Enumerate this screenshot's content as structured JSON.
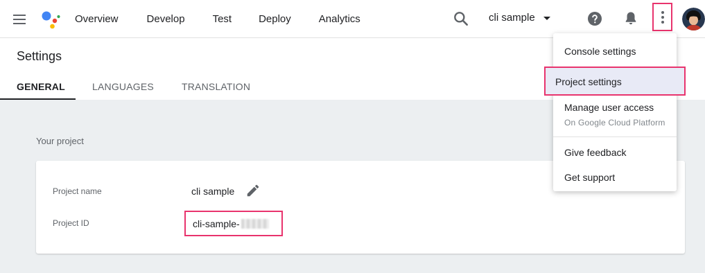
{
  "nav": {
    "items": [
      {
        "label": "Overview"
      },
      {
        "label": "Develop"
      },
      {
        "label": "Test"
      },
      {
        "label": "Deploy"
      },
      {
        "label": "Analytics"
      }
    ]
  },
  "project_selector": {
    "value": "cli sample"
  },
  "settings": {
    "title": "Settings",
    "tabs": [
      {
        "label": "GENERAL",
        "active": true
      },
      {
        "label": "LANGUAGES",
        "active": false
      },
      {
        "label": "TRANSLATION",
        "active": false
      }
    ]
  },
  "your_project": {
    "section_label": "Your project",
    "fields": [
      {
        "label": "Project name",
        "value": "cli sample"
      },
      {
        "label": "Project ID",
        "value": "cli-sample-"
      }
    ]
  },
  "more_menu": {
    "items": [
      {
        "label": "Console settings"
      },
      {
        "label": "Project settings"
      },
      {
        "label": "Manage user access",
        "sublabel": "On Google Cloud Platform"
      },
      {
        "label": "Give feedback"
      },
      {
        "label": "Get support"
      }
    ]
  },
  "colors": {
    "highlight": "#e8336d",
    "selected_bg": "#e8eaf6",
    "page_bg": "#eceff1"
  },
  "icons": [
    "menu-icon",
    "google-assistant-logo",
    "search-icon",
    "help-icon",
    "bell-icon",
    "more-vert-icon",
    "avatar",
    "pencil-icon"
  ]
}
